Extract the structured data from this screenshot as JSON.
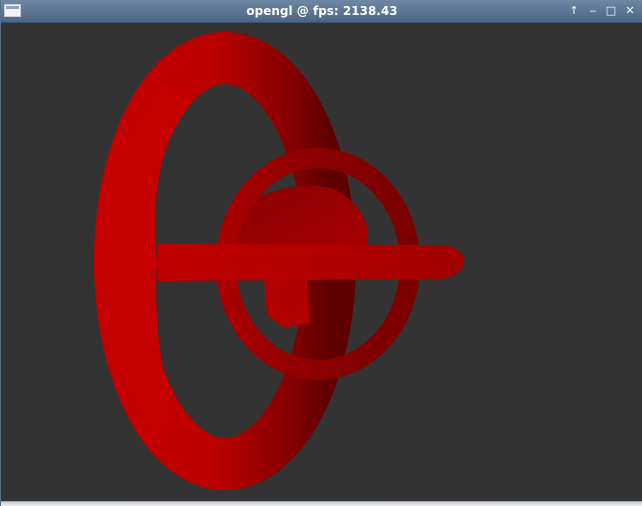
{
  "window": {
    "title": "opengl @ fps: 2138.43",
    "buttons": {
      "up": "↑",
      "minimize": "‒",
      "maximize": "□",
      "close": "✕"
    }
  },
  "scene": {
    "background_color": "#333333",
    "object_color": "#c00000"
  }
}
